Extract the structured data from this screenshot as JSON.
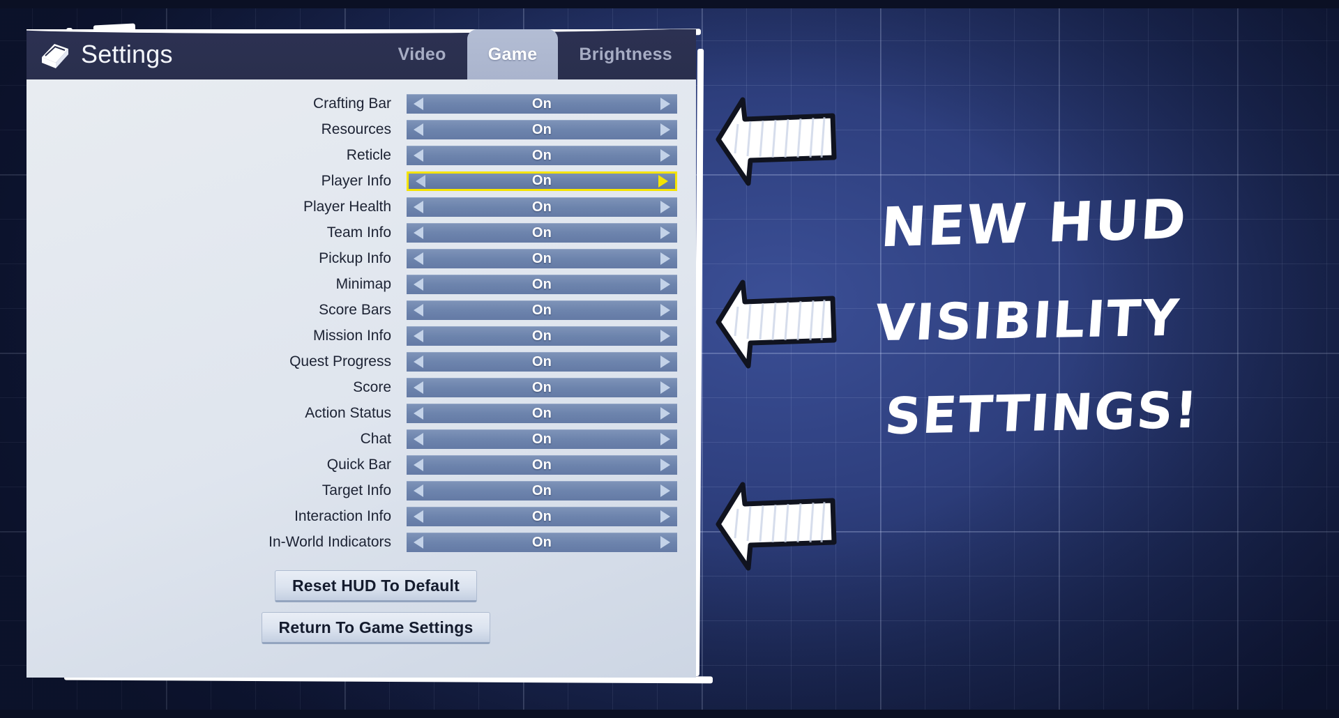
{
  "window": {
    "title": "Settings",
    "icon": "book-icon"
  },
  "tabs": [
    {
      "label": "Video",
      "active": false
    },
    {
      "label": "Game",
      "active": true
    },
    {
      "label": "Brightness",
      "active": false
    }
  ],
  "settings": {
    "value_on": "On",
    "rows": [
      {
        "label": "Crafting Bar",
        "value": "On",
        "highlighted": false
      },
      {
        "label": "Resources",
        "value": "On",
        "highlighted": false
      },
      {
        "label": "Reticle",
        "value": "On",
        "highlighted": false
      },
      {
        "label": "Player Info",
        "value": "On",
        "highlighted": true
      },
      {
        "label": "Player Health",
        "value": "On",
        "highlighted": false
      },
      {
        "label": "Team Info",
        "value": "On",
        "highlighted": false
      },
      {
        "label": "Pickup Info",
        "value": "On",
        "highlighted": false
      },
      {
        "label": "Minimap",
        "value": "On",
        "highlighted": false
      },
      {
        "label": "Score Bars",
        "value": "On",
        "highlighted": false
      },
      {
        "label": "Mission Info",
        "value": "On",
        "highlighted": false
      },
      {
        "label": "Quest Progress",
        "value": "On",
        "highlighted": false
      },
      {
        "label": "Score",
        "value": "On",
        "highlighted": false
      },
      {
        "label": "Action Status",
        "value": "On",
        "highlighted": false
      },
      {
        "label": "Chat",
        "value": "On",
        "highlighted": false
      },
      {
        "label": "Quick Bar",
        "value": "On",
        "highlighted": false
      },
      {
        "label": "Target Info",
        "value": "On",
        "highlighted": false
      },
      {
        "label": "Interaction Info",
        "value": "On",
        "highlighted": false
      },
      {
        "label": "In-World Indicators",
        "value": "On",
        "highlighted": false
      }
    ]
  },
  "footer": {
    "reset_label": "Reset HUD To Default",
    "return_label": "Return To Game Settings"
  },
  "annotation": {
    "line1": "NEW HUD",
    "line2": "VISIBILITY",
    "line3": "SETTINGS!",
    "arrow_count": 3,
    "arrow_direction": "left"
  },
  "colors": {
    "highlight": "#f5e400",
    "slider": "#6d84ad",
    "header": "#2a2f4d",
    "panel_body": "#e2e8f0",
    "background": "#2e3f7e",
    "annotation_text": "#ffffff"
  }
}
